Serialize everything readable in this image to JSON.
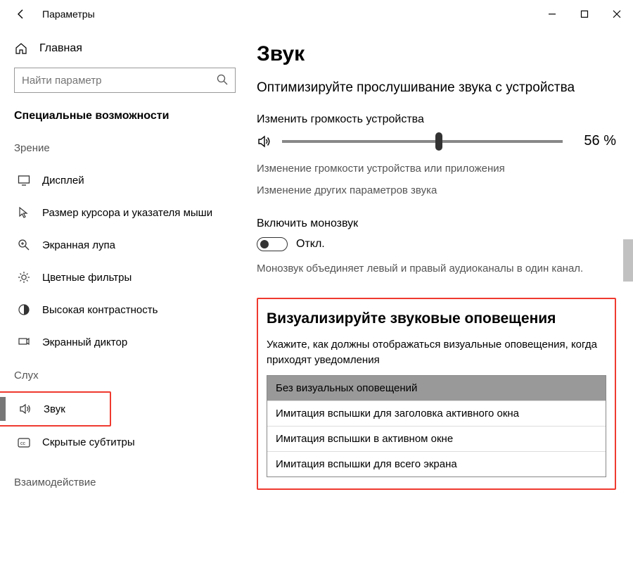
{
  "titlebar": {
    "title": "Параметры"
  },
  "sidebar": {
    "home": "Главная",
    "search_placeholder": "Найти параметр",
    "section": "Специальные возможности",
    "group_vision": "Зрение",
    "group_hearing": "Слух",
    "group_interaction": "Взаимодействие",
    "items": {
      "display": "Дисплей",
      "cursor": "Размер курсора и указателя мыши",
      "magnifier": "Экранная лупа",
      "color_filters": "Цветные фильтры",
      "high_contrast": "Высокая контрастность",
      "narrator": "Экранный диктор",
      "sound": "Звук",
      "captions": "Скрытые субтитры"
    }
  },
  "content": {
    "page_title": "Звук",
    "lead": "Оптимизируйте прослушивание звука с устройства",
    "volume_label": "Изменить громкость устройства",
    "volume_percent": 56,
    "volume_display": "56 %",
    "change_app_volume": "Изменение громкости устройства или приложения",
    "other_sound": "Изменение других параметров звука",
    "mono_label": "Включить монозвук",
    "mono_state": "Откл.",
    "mono_desc": "Монозвук объединяет левый и правый аудиоканалы в один канал.",
    "visual_alerts": {
      "heading": "Визуализируйте звуковые оповещения",
      "sub": "Укажите, как должны отображаться визуальные оповещения, когда приходят уведомления",
      "options": [
        "Без визуальных оповещений",
        "Имитация вспышки для заголовка активного окна",
        "Имитация вспышки в активном окне",
        "Имитация вспышки для всего экрана"
      ],
      "selected_index": 0
    }
  }
}
